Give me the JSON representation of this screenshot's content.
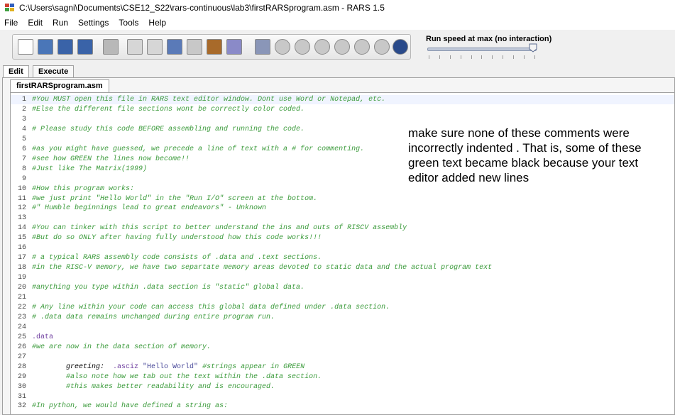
{
  "window": {
    "title": "C:\\Users\\sagni\\Documents\\CSE12_S22\\rars-continuous\\lab3\\firstRARSprogram.asm  - RARS 1.5"
  },
  "menu": [
    {
      "label": "File",
      "name": "menu-file"
    },
    {
      "label": "Edit",
      "name": "menu-edit"
    },
    {
      "label": "Run",
      "name": "menu-run"
    },
    {
      "label": "Settings",
      "name": "menu-settings"
    },
    {
      "label": "Tools",
      "name": "menu-tools"
    },
    {
      "label": "Help",
      "name": "menu-help"
    }
  ],
  "toolbar": {
    "buttons": [
      {
        "name": "new-file-button",
        "icon": "new-file-icon",
        "color": "#ffffff"
      },
      {
        "name": "open-file-button",
        "icon": "folder-open-icon",
        "color": "#4a76b8"
      },
      {
        "name": "save-button",
        "icon": "save-icon",
        "color": "#3a63a8"
      },
      {
        "name": "save-as-button",
        "icon": "save-as-icon",
        "color": "#3a63a8"
      },
      {
        "name": "dump-memory-button",
        "icon": "dump-icon",
        "color": "#b8b8b8"
      },
      {
        "name": "undo-button",
        "icon": "undo-icon",
        "color": "#d6d6d6"
      },
      {
        "name": "redo-button",
        "icon": "redo-icon",
        "color": "#d6d6d6"
      },
      {
        "name": "cut-button",
        "icon": "scissors-icon",
        "color": "#5a7ab8"
      },
      {
        "name": "copy-button",
        "icon": "copy-icon",
        "color": "#c8c8c8"
      },
      {
        "name": "paste-button",
        "icon": "clipboard-icon",
        "color": "#a86a2a"
      },
      {
        "name": "find-replace-button",
        "icon": "find-replace-icon",
        "color": "#8a8ac8"
      },
      {
        "name": "assemble-button",
        "icon": "wrench-icon",
        "color": "#8a96b8"
      },
      {
        "name": "run-button",
        "icon": "run-icon",
        "color": "#c8c8c8"
      },
      {
        "name": "step-button",
        "icon": "step-icon",
        "color": "#c8c8c8"
      },
      {
        "name": "backstep-button",
        "icon": "backstep-icon",
        "color": "#c8c8c8"
      },
      {
        "name": "pause-button",
        "icon": "pause-icon",
        "color": "#c8c8c8"
      },
      {
        "name": "stop-button",
        "icon": "stop-icon",
        "color": "#c8c8c8"
      },
      {
        "name": "reset-button",
        "icon": "reset-icon",
        "color": "#c8c8c8"
      },
      {
        "name": "help-button",
        "icon": "help-icon",
        "color": "#2a4a8a"
      }
    ],
    "speed_label": "Run speed at max (no interaction)",
    "speed_fraction": 1.0
  },
  "tabs": {
    "edit": "Edit",
    "execute": "Execute"
  },
  "file_tab": "firstRARSprogram.asm",
  "colors": {
    "comment": "#3a9a3a",
    "directive": "#7040a0",
    "string": "#4a4a9a",
    "line_highlight": "#f0f4ff"
  },
  "code_lines": [
    {
      "n": "1",
      "text": "#You MUST open this file in RARS text editor window. Dont use Word or Notepad, etc.",
      "kind": "comment"
    },
    {
      "n": "2",
      "text": "#Else the different file sections wont be correctly color coded.",
      "kind": "comment"
    },
    {
      "n": "3",
      "text": "",
      "kind": "blank"
    },
    {
      "n": "4",
      "text": "# Please study this code BEFORE assembling and running the code.",
      "kind": "comment"
    },
    {
      "n": "5",
      "text": "",
      "kind": "blank"
    },
    {
      "n": "6",
      "text": "#as you might have guessed, we precede a line of text with a # for commenting.",
      "kind": "comment"
    },
    {
      "n": "7",
      "text": "#see how GREEN the lines now become!!",
      "kind": "comment"
    },
    {
      "n": "8",
      "text": "#Just like The Matrix(1999)",
      "kind": "comment"
    },
    {
      "n": "9",
      "text": "",
      "kind": "blank"
    },
    {
      "n": "10",
      "text": "#How this program works:",
      "kind": "comment"
    },
    {
      "n": "11",
      "text": "#we just print \"Hello World\" in the \"Run I/O\" screen at the bottom.",
      "kind": "comment"
    },
    {
      "n": "12",
      "text": "#\" Humble beginnings lead to great endeavors\" - Unknown",
      "kind": "comment"
    },
    {
      "n": "13",
      "text": "",
      "kind": "blank"
    },
    {
      "n": "14",
      "text": "#You can tinker with this script to better understand the ins and outs of RISCV assembly",
      "kind": "comment"
    },
    {
      "n": "15",
      "text": "#But do so ONLY after having fully understood how this code works!!!",
      "kind": "comment"
    },
    {
      "n": "16",
      "text": "",
      "kind": "blank"
    },
    {
      "n": "17",
      "text": "# a typical RARS assembly code consists of .data and .text sections.",
      "kind": "comment"
    },
    {
      "n": "18",
      "text": "#in the RISC-V memory, we have two separtate memory areas devoted to static data and the actual program text",
      "kind": "comment"
    },
    {
      "n": "19",
      "text": "",
      "kind": "blank"
    },
    {
      "n": "20",
      "text": "#anything you type within .data section is \"static\" global data.",
      "kind": "comment"
    },
    {
      "n": "21",
      "text": "",
      "kind": "blank"
    },
    {
      "n": "22",
      "text": "# Any line within your code can access this global data defined under .data section.",
      "kind": "comment"
    },
    {
      "n": "23",
      "text": "# .data data remains unchanged during entire program run.",
      "kind": "comment"
    },
    {
      "n": "24",
      "text": "",
      "kind": "blank"
    },
    {
      "n": "25",
      "text": ".data",
      "kind": "directive"
    },
    {
      "n": "26",
      "text": "#we are now in the data section of memory.",
      "kind": "comment"
    },
    {
      "n": "27",
      "text": "",
      "kind": "blank"
    },
    {
      "n": "28",
      "text": "",
      "kind": "asciz",
      "label": "        greeting:  ",
      "dir": ".asciz",
      "str": " \"Hello World\" ",
      "cmt": "#strings appear in GREEN"
    },
    {
      "n": "29",
      "text": "        #also note how we tab out the text within the .data section.",
      "kind": "comment"
    },
    {
      "n": "30",
      "text": "        #this makes better readability and is encouraged.",
      "kind": "comment"
    },
    {
      "n": "31",
      "text": "",
      "kind": "blank"
    },
    {
      "n": "32",
      "text": "#In python, we would have defined a string as:",
      "kind": "comment"
    }
  ],
  "note": "make sure none of these comments were incorrectly indented . That is, some of these green text became black because your text editor added new lines"
}
